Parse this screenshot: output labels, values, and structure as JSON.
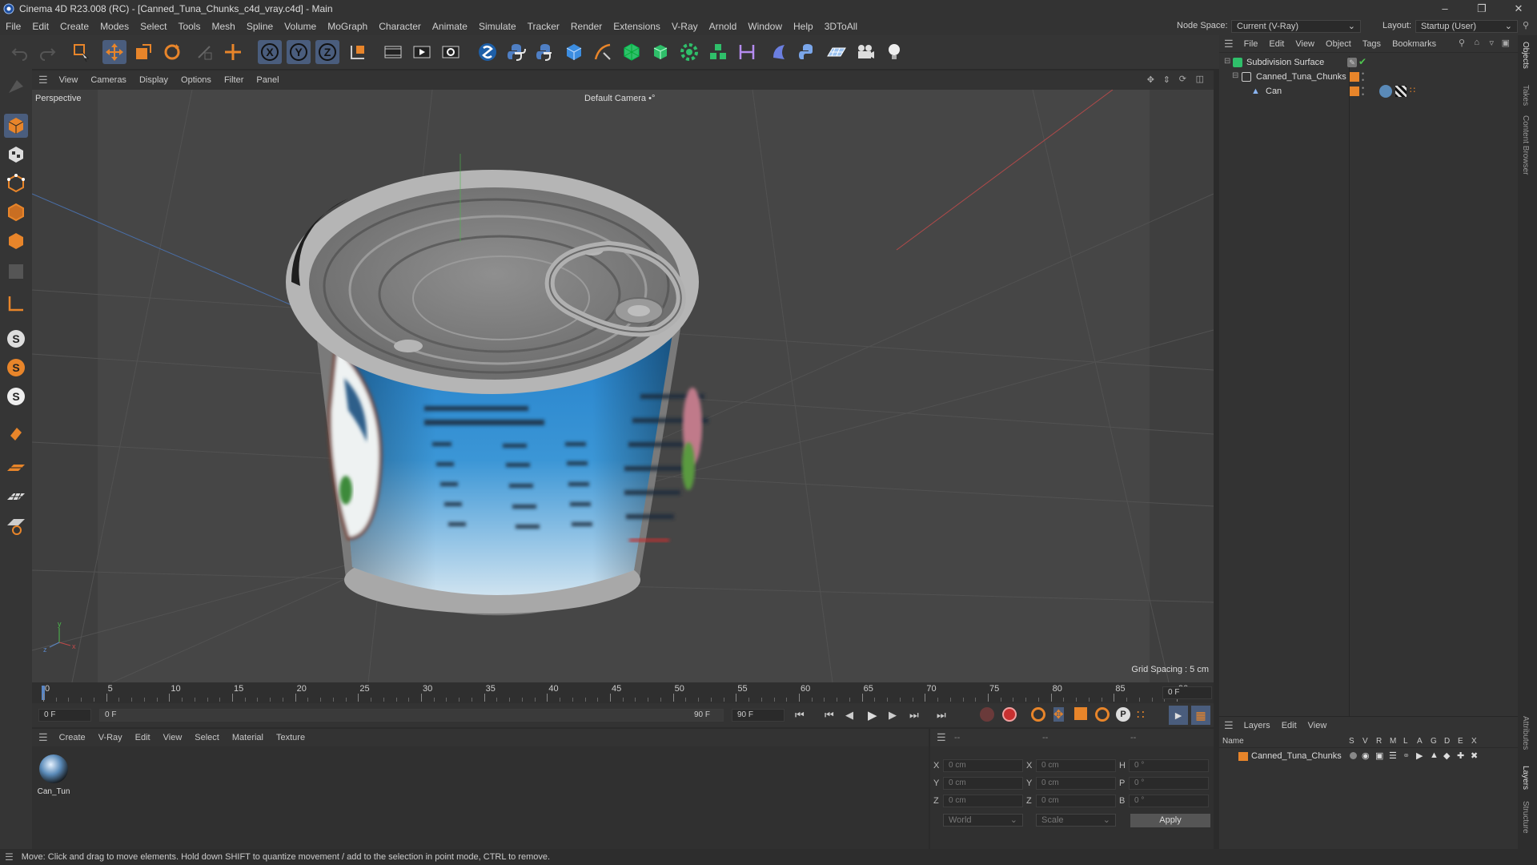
{
  "app": {
    "title": "Cinema 4D R23.008 (RC) - [Canned_Tuna_Chunks_c4d_vray.c4d] - Main",
    "minimize": "–",
    "restore": "❐",
    "close": "✕"
  },
  "menu": [
    "File",
    "Edit",
    "Create",
    "Modes",
    "Select",
    "Tools",
    "Mesh",
    "Spline",
    "Volume",
    "MoGraph",
    "Character",
    "Animate",
    "Simulate",
    "Tracker",
    "Render",
    "Extensions",
    "V-Ray",
    "Arnold",
    "Window",
    "Help",
    "3DToAll"
  ],
  "node_space": {
    "label": "Node Space:",
    "value": "Current (V-Ray)"
  },
  "layout": {
    "label": "Layout:",
    "value": "Startup (User)"
  },
  "viewport": {
    "menu": [
      "View",
      "Cameras",
      "Display",
      "Options",
      "Filter",
      "Panel"
    ],
    "name": "Perspective",
    "camera": "Default Camera •°",
    "grid_spacing": "Grid Spacing : 5 cm"
  },
  "timeline": {
    "ticks": [
      "0",
      "5",
      "10",
      "15",
      "20",
      "25",
      "30",
      "35",
      "40",
      "45",
      "50",
      "55",
      "60",
      "65",
      "70",
      "75",
      "80",
      "85",
      "90"
    ],
    "current_frame_right": "0 F",
    "start_field": "0 F",
    "range_start": "0 F",
    "range_end": "90 F",
    "end_field": "90 F"
  },
  "objects_panel": {
    "menu": [
      "File",
      "Edit",
      "View",
      "Object",
      "Tags",
      "Bookmarks"
    ],
    "items": [
      {
        "name": "Subdivision Surface"
      },
      {
        "name": "Canned_Tuna_Chunks"
      },
      {
        "name": "Can"
      }
    ]
  },
  "layers_panel": {
    "menu": [
      "Layers",
      "Edit",
      "View"
    ],
    "header": {
      "name": "Name",
      "cols": [
        "S",
        "V",
        "R",
        "M",
        "L",
        "A",
        "G",
        "D",
        "E",
        "X"
      ]
    },
    "rows": [
      {
        "name": "Canned_Tuna_Chunks"
      }
    ]
  },
  "material_manager": {
    "menu": [
      "Create",
      "V-Ray",
      "Edit",
      "View",
      "Select",
      "Material",
      "Texture"
    ],
    "materials": [
      {
        "name": "Can_Tun"
      }
    ]
  },
  "coordinates": {
    "header": [
      "--",
      "--",
      "--"
    ],
    "rows": [
      {
        "a": "X",
        "av": "0 cm",
        "b": "X",
        "bv": "0 cm",
        "c": "H",
        "cv": "0 °"
      },
      {
        "a": "Y",
        "av": "0 cm",
        "b": "Y",
        "bv": "0 cm",
        "c": "P",
        "cv": "0 °"
      },
      {
        "a": "Z",
        "av": "0 cm",
        "b": "Z",
        "bv": "0 cm",
        "c": "B",
        "cv": "0 °"
      }
    ],
    "space": "World",
    "mode": "Scale",
    "apply": "Apply"
  },
  "right_tabs": [
    "Objects",
    "Takes",
    "Content Browser",
    "Attributes",
    "Layers",
    "Structure"
  ],
  "status": "Move: Click and drag to move elements. Hold down SHIFT to quantize movement / add to the selection in point mode, CTRL to remove.",
  "colors": {
    "accent_orange": "#e8852a",
    "active_blue": "#5a86c4",
    "green_check": "#4fc44f"
  }
}
